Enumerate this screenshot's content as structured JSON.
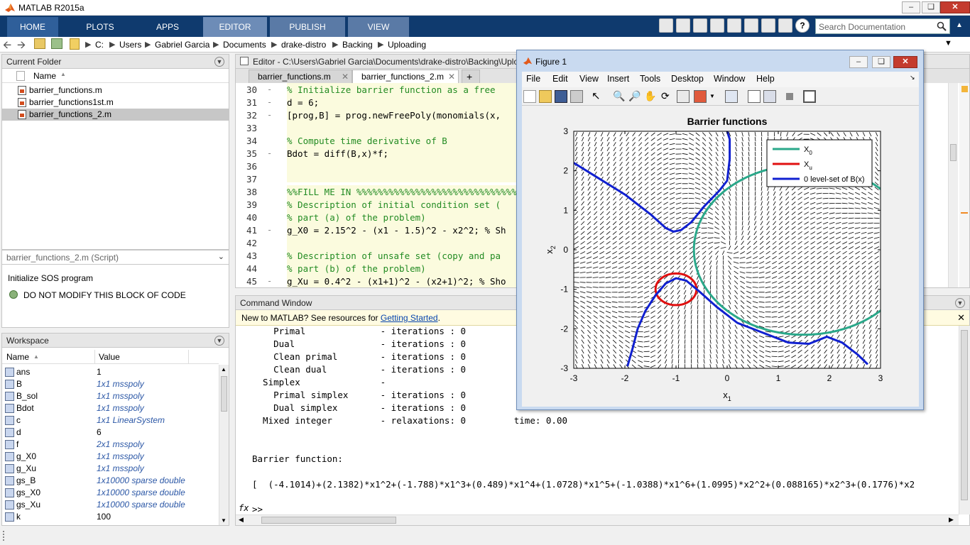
{
  "app": {
    "title": "MATLAB R2015a"
  },
  "ribbon": {
    "tabs": [
      "HOME",
      "PLOTS",
      "APPS",
      "EDITOR",
      "PUBLISH",
      "VIEW"
    ],
    "search_placeholder": "Search Documentation"
  },
  "path": {
    "crumbs": [
      "C:",
      "Users",
      "Gabriel Garcia",
      "Documents",
      "drake-distro",
      "Backing",
      "Uploading"
    ]
  },
  "current_folder": {
    "header": "Current Folder",
    "col_name": "Name",
    "files": [
      "barrier_functions.m",
      "barrier_functions1st.m",
      "barrier_functions_2.m"
    ],
    "selected_index": 2
  },
  "details": {
    "header": "barrier_functions_2.m  (Script)",
    "line1": "Initialize SOS program",
    "line2": "DO NOT MODIFY THIS BLOCK OF CODE"
  },
  "workspace": {
    "header": "Workspace",
    "col_name": "Name",
    "col_value": "Value",
    "vars": [
      {
        "name": "ans",
        "value": "1",
        "italic": false
      },
      {
        "name": "B",
        "value": "1x1 msspoly",
        "italic": true
      },
      {
        "name": "B_sol",
        "value": "1x1 msspoly",
        "italic": true
      },
      {
        "name": "Bdot",
        "value": "1x1 msspoly",
        "italic": true
      },
      {
        "name": "c",
        "value": "1x1 LinearSystem",
        "italic": true
      },
      {
        "name": "d",
        "value": "6",
        "italic": false
      },
      {
        "name": "f",
        "value": "2x1 msspoly",
        "italic": true
      },
      {
        "name": "g_X0",
        "value": "1x1 msspoly",
        "italic": true
      },
      {
        "name": "g_Xu",
        "value": "1x1 msspoly",
        "italic": true
      },
      {
        "name": "gs_B",
        "value": "1x10000 sparse double",
        "italic": true
      },
      {
        "name": "gs_X0",
        "value": "1x10000 sparse double",
        "italic": true
      },
      {
        "name": "gs_Xu",
        "value": "1x10000 sparse double",
        "italic": true
      },
      {
        "name": "k",
        "value": "100",
        "italic": false
      }
    ]
  },
  "editor": {
    "header": "Editor - C:\\Users\\Gabriel Garcia\\Documents\\drake-distro\\Backing\\Uplo",
    "tabs": [
      "barrier_functions.m",
      "barrier_functions_2.m"
    ],
    "lines": [
      {
        "n": "30",
        "dash": true,
        "text": "% Initialize barrier function as a free",
        "comment": true
      },
      {
        "n": "31",
        "dash": true,
        "text": "d = 6;",
        "comment": false
      },
      {
        "n": "32",
        "dash": true,
        "text": "[prog,B] = prog.newFreePoly(monomials(x,",
        "comment": false
      },
      {
        "n": "33",
        "dash": false,
        "text": "",
        "comment": false
      },
      {
        "n": "34",
        "dash": false,
        "text": "% Compute time derivative of B",
        "comment": true
      },
      {
        "n": "35",
        "dash": true,
        "text": "Bdot = diff(B,x)*f;",
        "comment": false
      },
      {
        "n": "36",
        "dash": false,
        "text": "",
        "comment": false
      },
      {
        "n": "37",
        "dash": false,
        "text": "",
        "comment": false
      },
      {
        "n": "38",
        "dash": false,
        "text": "%%FILL ME IN %%%%%%%%%%%%%%%%%%%%%%%%%%%%%%%%%",
        "comment": true
      },
      {
        "n": "39",
        "dash": false,
        "text": "% Description of initial condition set (",
        "comment": true
      },
      {
        "n": "40",
        "dash": false,
        "text": "% part (a) of the problem)",
        "comment": true
      },
      {
        "n": "41",
        "dash": true,
        "text": "g_X0 = 2.15^2 - (x1 - 1.5)^2 - x2^2; % Sh",
        "comment": false
      },
      {
        "n": "42",
        "dash": false,
        "text": "",
        "comment": false
      },
      {
        "n": "43",
        "dash": false,
        "text": "% Description of unsafe set (copy and pa",
        "comment": true
      },
      {
        "n": "44",
        "dash": false,
        "text": "% part (b) of the problem)",
        "comment": true
      },
      {
        "n": "45",
        "dash": true,
        "text": "g_Xu = 0.4^2 - (x1+1)^2 - (x2+1)^2; % Sho",
        "comment": false
      }
    ]
  },
  "command_window": {
    "header": "Command Window",
    "banner_text": "New to MATLAB? See resources for ",
    "banner_link": "Getting Started",
    "banner_end": ".",
    "lines": [
      "    Primal              - iterations : 0",
      "    Dual                - iterations : 0",
      "    Clean primal        - iterations : 0",
      "    Clean dual          - iterations : 0",
      "  Simplex               -",
      "    Primal simplex      - iterations : 0",
      "    Dual simplex        - iterations : 0",
      "  Mixed integer         - relaxations: 0         time: 0.00",
      "",
      "",
      "Barrier function:",
      "",
      "[  (-4.1014)+(2.1382)*x1^2+(-1.788)*x1^3+(0.489)*x1^4+(1.0728)*x1^5+(-1.0388)*x1^6+(1.0995)*x2^2+(0.088165)*x2^3+(0.1776)*x2"
    ],
    "prompt": ">>",
    "fx": "fx"
  },
  "figure": {
    "title": "Figure 1",
    "menus": [
      "File",
      "Edit",
      "View",
      "Insert",
      "Tools",
      "Desktop",
      "Window",
      "Help"
    ]
  },
  "colors": {
    "ribbon": "#0f3a6e",
    "x0": "#2aa88a",
    "xu": "#e01010",
    "levelset": "#1020d0"
  },
  "chart_data": {
    "type": "line",
    "title": "Barrier functions",
    "xlabel": "x1",
    "ylabel": "x2",
    "xlim": [
      -3,
      3
    ],
    "ylim": [
      -3,
      3
    ],
    "xticks": [
      "-3",
      "-2",
      "-1",
      "0",
      "1",
      "2",
      "3"
    ],
    "yticks": [
      "3",
      "2",
      "1",
      "0",
      "-1",
      "-2",
      "-3"
    ],
    "legend": {
      "placement": "top-right",
      "entries": [
        "X_0",
        "X_u",
        "0 level-set of B(x)"
      ]
    },
    "legend_sub": [
      "0",
      "u"
    ],
    "series": [
      {
        "name": "X_0",
        "kind": "circle",
        "cx": 1.5,
        "cy": 0,
        "r": 2.15
      },
      {
        "name": "X_u",
        "kind": "circle",
        "cx": -1,
        "cy": -1,
        "r": 0.4
      },
      {
        "name": "0 level-set of B(x)",
        "kind": "curves",
        "curves": [
          [
            [
              -3.0,
              2.2
            ],
            [
              -2.5,
              1.8
            ],
            [
              -2.0,
              1.4
            ],
            [
              -1.5,
              0.9
            ],
            [
              -1.2,
              0.55
            ],
            [
              -1.05,
              0.46
            ],
            [
              -0.9,
              0.5
            ],
            [
              -0.7,
              0.7
            ],
            [
              -0.45,
              1.1
            ],
            [
              -0.15,
              1.5
            ],
            [
              0.0,
              1.75
            ],
            [
              0.05,
              2.3
            ],
            [
              0.05,
              2.8
            ],
            [
              0.0,
              3.0
            ]
          ],
          [
            [
              -1.95,
              -2.95
            ],
            [
              -1.85,
              -2.5
            ],
            [
              -1.75,
              -2.0
            ],
            [
              -1.6,
              -1.55
            ],
            [
              -1.4,
              -1.15
            ],
            [
              -1.2,
              -0.85
            ],
            [
              -1.0,
              -0.72
            ],
            [
              -0.8,
              -0.78
            ],
            [
              -0.55,
              -1.05
            ],
            [
              -0.2,
              -1.45
            ],
            [
              0.2,
              -1.85
            ],
            [
              0.7,
              -2.1
            ],
            [
              1.2,
              -2.35
            ],
            [
              1.6,
              -2.38
            ],
            [
              1.95,
              -2.2
            ],
            [
              2.25,
              -2.35
            ],
            [
              2.55,
              -2.65
            ],
            [
              2.75,
              -2.9
            ]
          ]
        ]
      }
    ],
    "vector_field": true
  }
}
